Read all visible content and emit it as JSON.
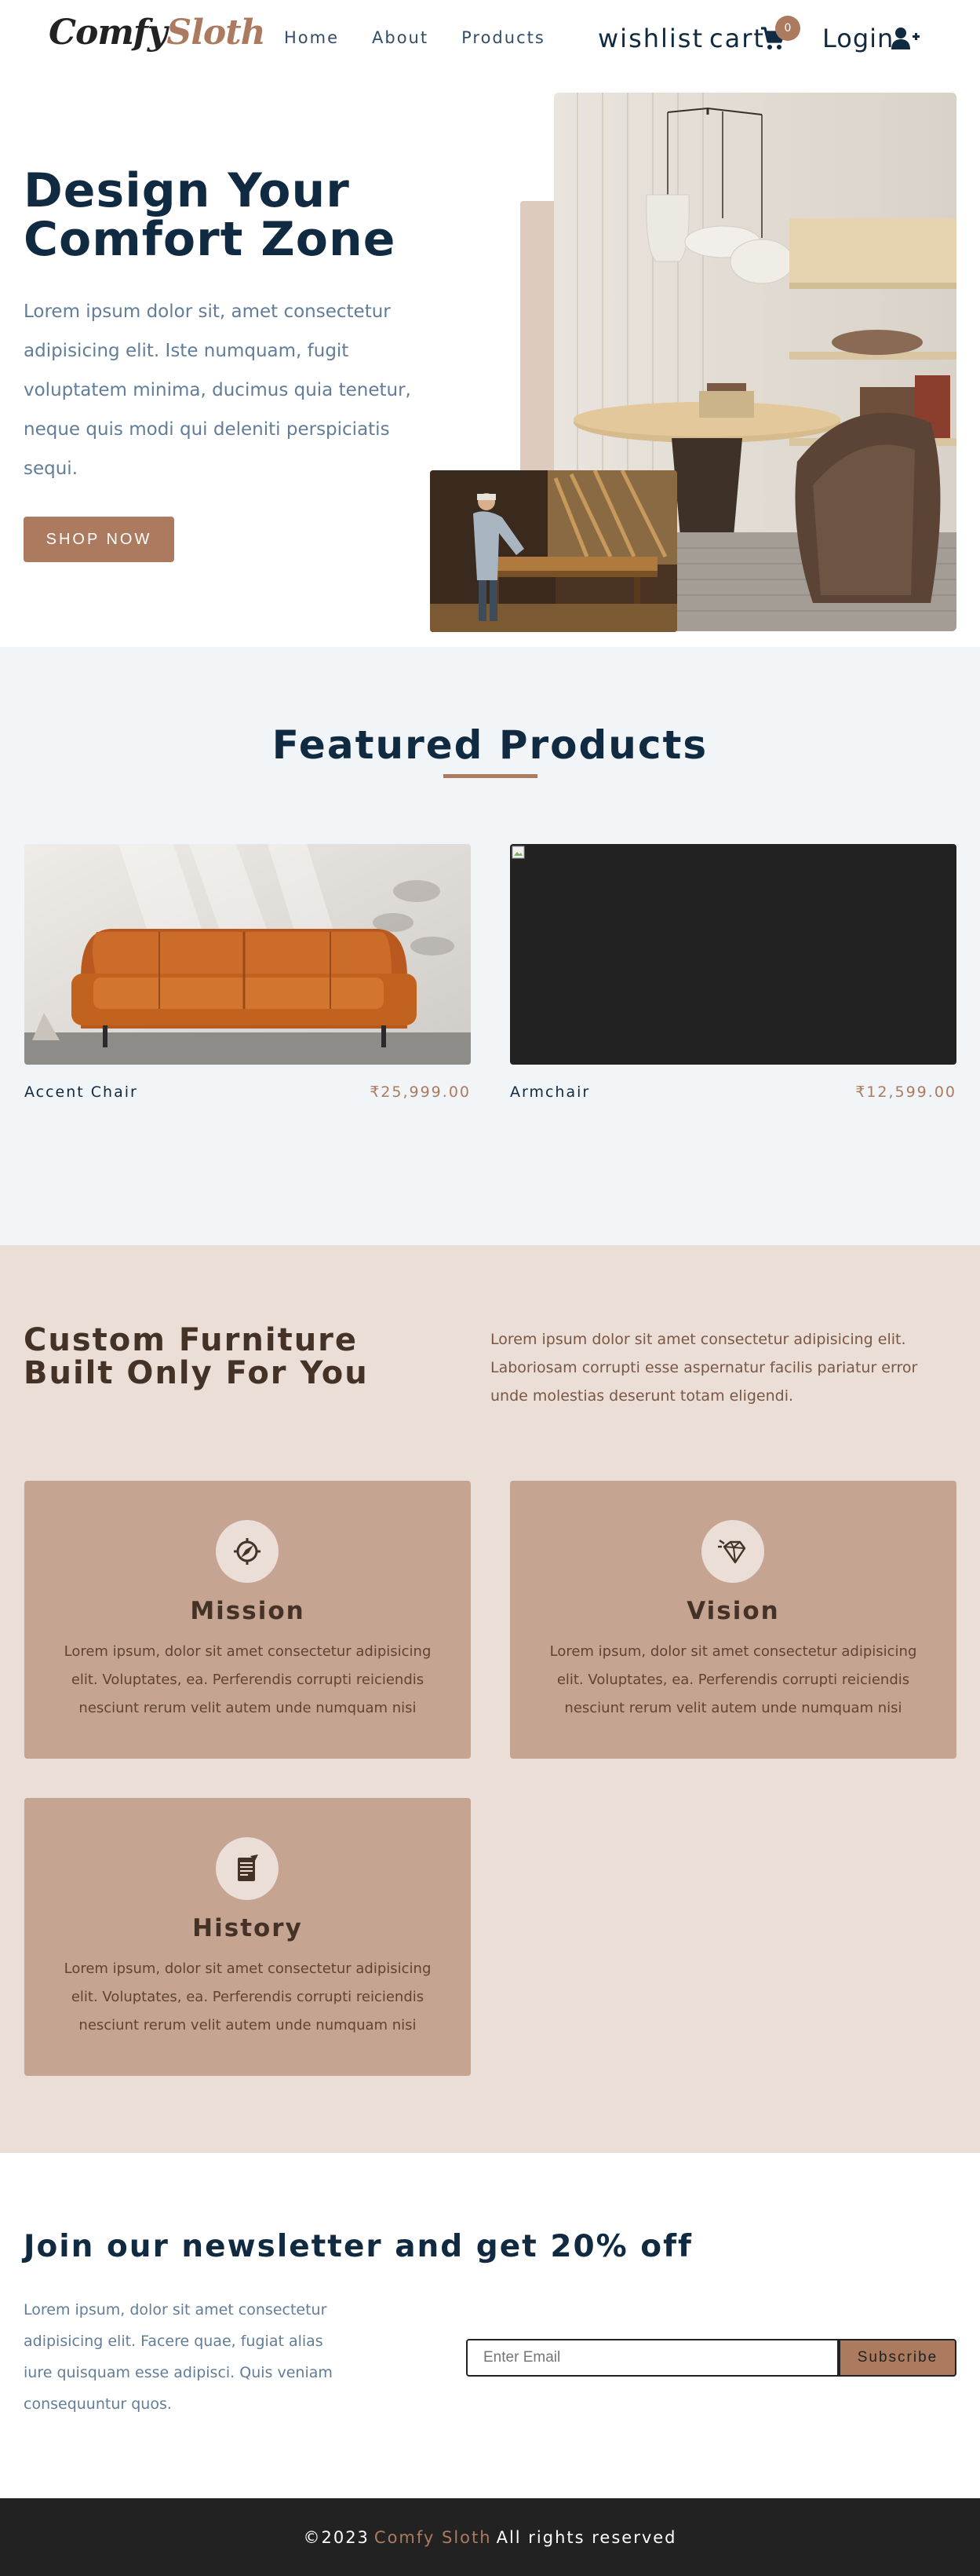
{
  "nav": {
    "logo_part1": "Comfy",
    "logo_part2": "Sloth",
    "links": [
      "Home",
      "About",
      "Products"
    ],
    "wishlist_label": "wishlist",
    "cart_label": "cart",
    "cart_count": "0",
    "login_label": "Login"
  },
  "hero": {
    "title": "Design Your Comfort Zone",
    "text": "Lorem ipsum dolor sit, amet consectetur adipisicing elit. Iste numquam, fugit voluptatem minima, ducimus quia tenetur, neque quis modi qui deleniti perspiciatis sequi.",
    "button": "SHOP NOW"
  },
  "featured": {
    "title": "Featured Products",
    "products": [
      {
        "name": "Accent Chair",
        "price": "₹25,999.00"
      },
      {
        "name": "Armchair",
        "price": "₹12,599.00"
      }
    ]
  },
  "services": {
    "title": "Custom Furniture Built Only For You",
    "intro": "Lorem ipsum dolor sit amet consectetur adipisicing elit. Laboriosam corrupti esse aspernatur facilis pariatur error unde molestias deserunt totam eligendi.",
    "items": [
      {
        "title": "Mission",
        "icon": "compass-icon",
        "text": "Lorem ipsum, dolor sit amet consectetur adipisicing elit. Voluptates, ea. Perferendis corrupti reiciendis nesciunt rerum velit autem unde numquam nisi"
      },
      {
        "title": "Vision",
        "icon": "diamond-icon",
        "text": "Lorem ipsum, dolor sit amet consectetur adipisicing elit. Voluptates, ea. Perferendis corrupti reiciendis nesciunt rerum velit autem unde numquam nisi"
      },
      {
        "title": "History",
        "icon": "scroll-icon",
        "text": "Lorem ipsum, dolor sit amet consectetur adipisicing elit. Voluptates, ea. Perferendis corrupti reiciendis nesciunt rerum velit autem unde numquam nisi"
      }
    ]
  },
  "newsletter": {
    "title": "Join our newsletter and get 20% off",
    "text": "Lorem ipsum, dolor sit amet consectetur adipisicing elit. Facere quae, fugiat alias iure quisquam esse adipisci. Quis veniam consequuntur quos.",
    "email_placeholder": "Enter Email",
    "subscribe_label": "Subscribe"
  },
  "footer": {
    "prefix": "©2023",
    "brand": "Comfy Sloth",
    "suffix": "All rights reserved"
  },
  "colors": {
    "primary": "#ab7a5f",
    "dark": "#102a42",
    "grey": "#617d98",
    "section_bg": "#f1f5f8",
    "services_bg": "#eaded7",
    "service_card": "#c5a491",
    "footer_bg": "#222222"
  }
}
